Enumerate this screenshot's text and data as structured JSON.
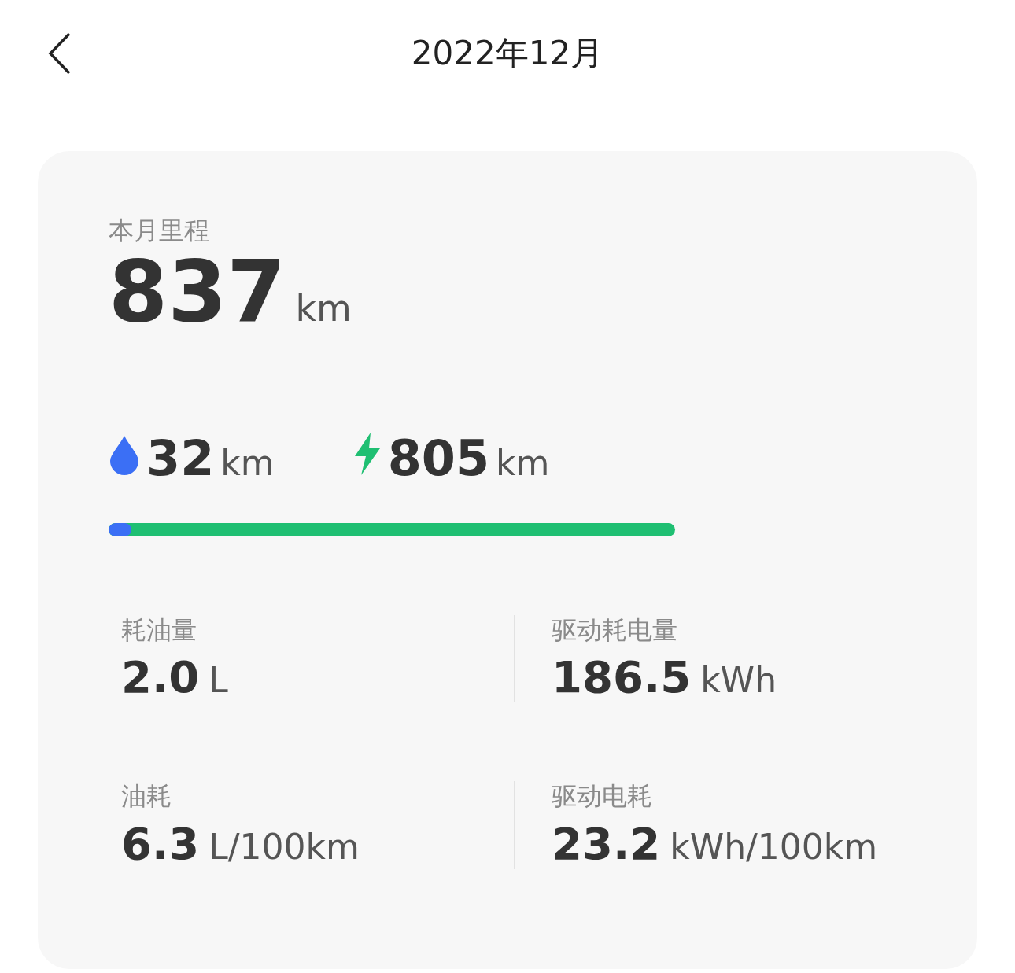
{
  "header": {
    "title": "2022年12月"
  },
  "mileage": {
    "label": "本月里程",
    "value": "837",
    "unit": "km"
  },
  "split": [
    {
      "kind": "fuel",
      "value": "32",
      "unit": "km"
    },
    {
      "kind": "electric",
      "value": "805",
      "unit": "km"
    }
  ],
  "bar": {
    "level": 0.04
  },
  "stats": [
    {
      "label": "耗油量",
      "value": "2.0",
      "unit": "L"
    },
    {
      "label": "驱动耗电量",
      "value": "186.5",
      "unit": "kWh"
    },
    {
      "label": "油耗",
      "value": "6.3",
      "unit": "L/100km"
    },
    {
      "label": "驱动电耗",
      "value": "23.2",
      "unit": "kWh/100km"
    }
  ]
}
